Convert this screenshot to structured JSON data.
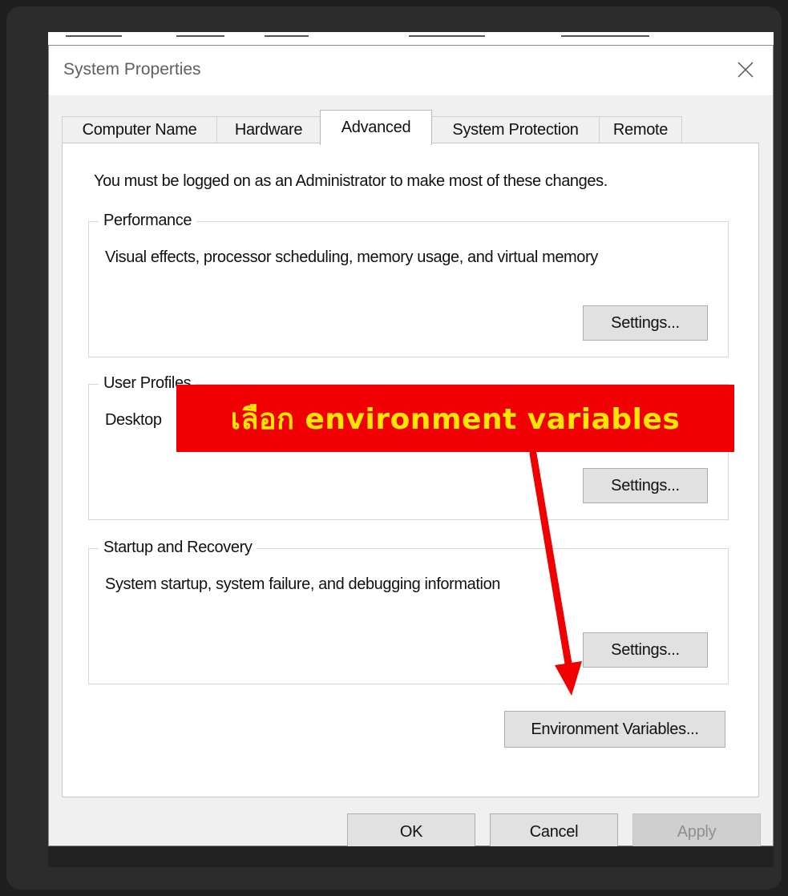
{
  "dialog": {
    "title": "System Properties",
    "close_icon": "close-icon"
  },
  "tabs": [
    {
      "label": "Computer Name"
    },
    {
      "label": "Hardware"
    },
    {
      "label": "Advanced"
    },
    {
      "label": "System Protection"
    },
    {
      "label": "Remote"
    }
  ],
  "active_tab": "Advanced",
  "notice": "You must be logged on as an Administrator to make most of these changes.",
  "groups": {
    "performance": {
      "title": "Performance",
      "description": "Visual effects, processor scheduling, memory usage, and virtual memory",
      "button": "Settings..."
    },
    "user_profiles": {
      "title": "User Profiles",
      "description": "Desktop",
      "button": "Settings..."
    },
    "startup_recovery": {
      "title": "Startup and Recovery",
      "description": "System startup, system failure, and debugging information",
      "button": "Settings..."
    }
  },
  "env_button": "Environment Variables...",
  "footer": {
    "ok": "OK",
    "cancel": "Cancel",
    "apply": "Apply"
  },
  "annotation": {
    "text": "เลือก environment variables",
    "bg_color": "#f00000",
    "text_color": "#ffe600"
  }
}
